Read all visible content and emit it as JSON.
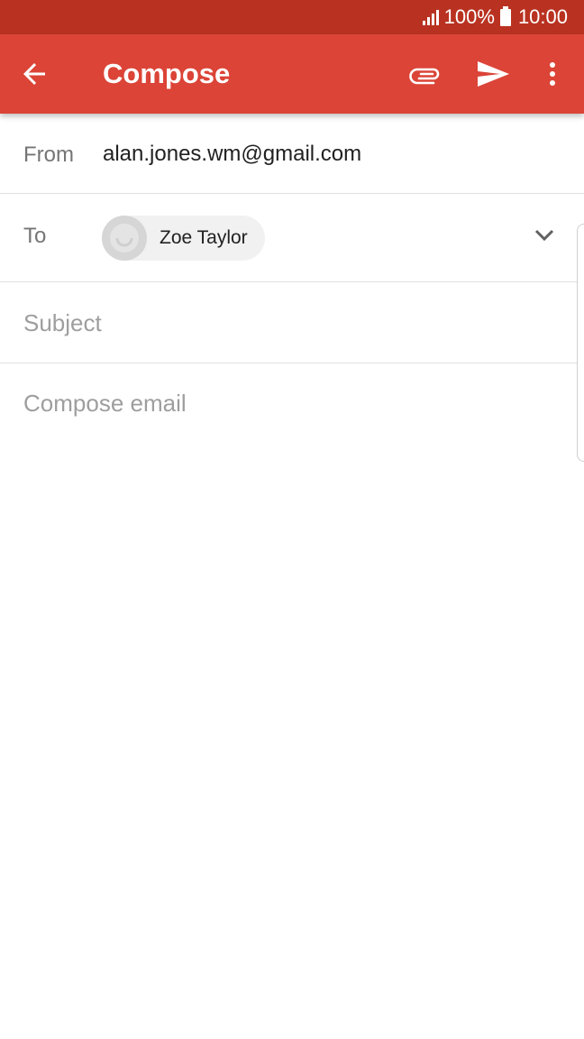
{
  "status_bar": {
    "battery": "100%",
    "time": "10:00",
    "icons": [
      "signal-icon",
      "battery-icon"
    ]
  },
  "app_bar": {
    "title": "Compose",
    "icons": [
      "back-arrow-icon",
      "paperclip-icon",
      "send-icon",
      "more-vert-icon"
    ],
    "color": "#db4437",
    "status_color": "#b93221"
  },
  "from": {
    "label": "From",
    "value": "alan.jones.wm@gmail.com"
  },
  "to": {
    "label": "To",
    "recipient": "Zoe Taylor",
    "icons": [
      "avatar-icon",
      "chevron-down-icon"
    ]
  },
  "subject": {
    "placeholder": "Subject"
  },
  "body": {
    "placeholder": "Compose email"
  }
}
